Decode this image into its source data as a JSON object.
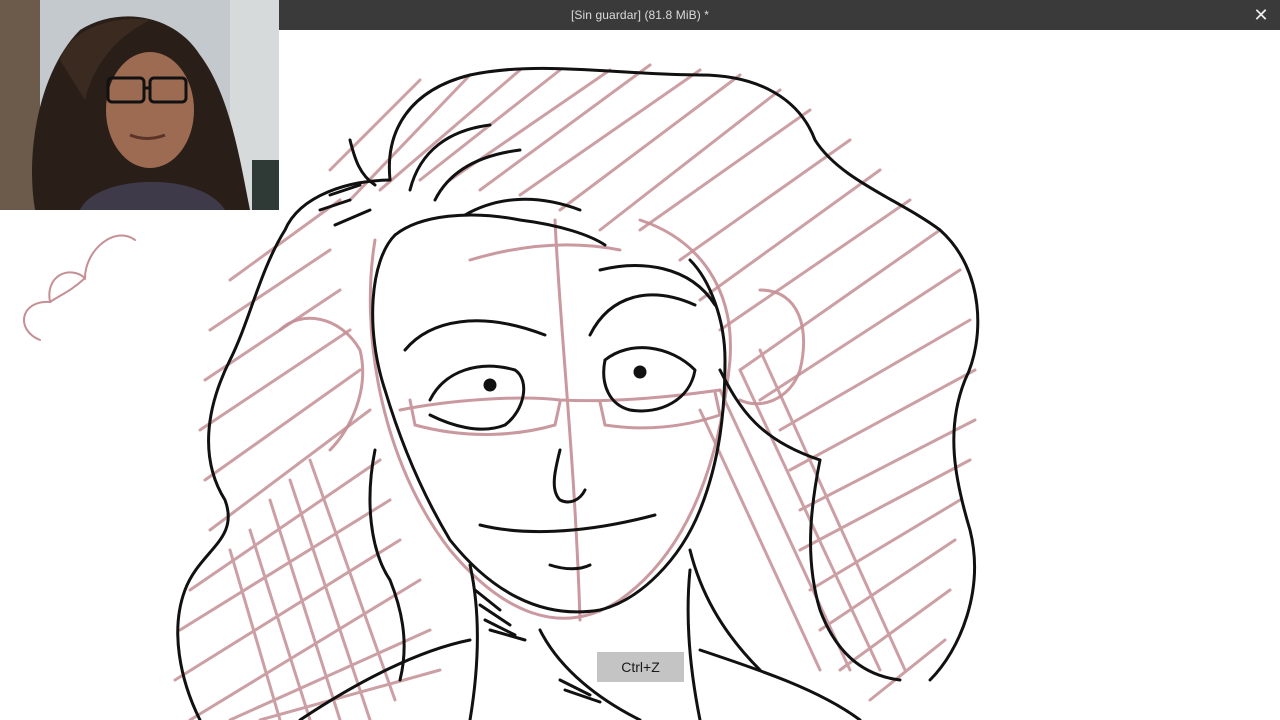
{
  "window": {
    "title": "[Sin guardar]  (81.8 MiB) *",
    "close_label": "✕"
  },
  "webcam": {
    "icon": "webcam-person-image"
  },
  "canvas": {
    "sketch_color": "#c48f95",
    "lineart_color": "#111111",
    "icon": "character-sketch"
  },
  "tooltip": {
    "shortcut": "Ctrl+Z"
  }
}
